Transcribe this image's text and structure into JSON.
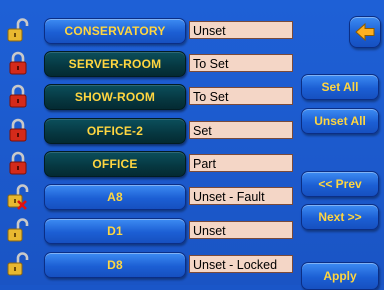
{
  "zones": [
    {
      "name": "CONSERVATORY",
      "status": "Unset",
      "lock": "unlocked-padlock-icon",
      "style": "blue"
    },
    {
      "name": "SERVER-ROOM",
      "status": "To Set",
      "lock": "locked-padlock-icon",
      "style": "dark"
    },
    {
      "name": "SHOW-ROOM",
      "status": "To Set",
      "lock": "locked-padlock-icon",
      "style": "dark"
    },
    {
      "name": "OFFICE-2",
      "status": "Set",
      "lock": "locked-padlock-icon",
      "style": "dark"
    },
    {
      "name": "OFFICE",
      "status": "Part",
      "lock": "locked-padlock-icon",
      "style": "dark"
    },
    {
      "name": "A8",
      "status": "Unset - Fault",
      "lock": "unlocked-padlock-fault-icon",
      "style": "blue"
    },
    {
      "name": "D1",
      "status": "Unset",
      "lock": "unlocked-padlock-icon",
      "style": "blue"
    },
    {
      "name": "D8",
      "status": "Unset - Locked",
      "lock": "unlocked-padlock-icon",
      "style": "blue"
    }
  ],
  "actions": {
    "set_all": "Set All",
    "unset_all": "Unset All",
    "prev": "<< Prev",
    "next": "Next >>",
    "apply": "Apply",
    "back_icon": "back-arrow-icon"
  },
  "colors": {
    "background": "#1e60d6",
    "button_text": "#ffd640",
    "status_field": "#f4d6c6",
    "lock_red": "#d42a1a",
    "lock_gold": "#e8b830"
  }
}
